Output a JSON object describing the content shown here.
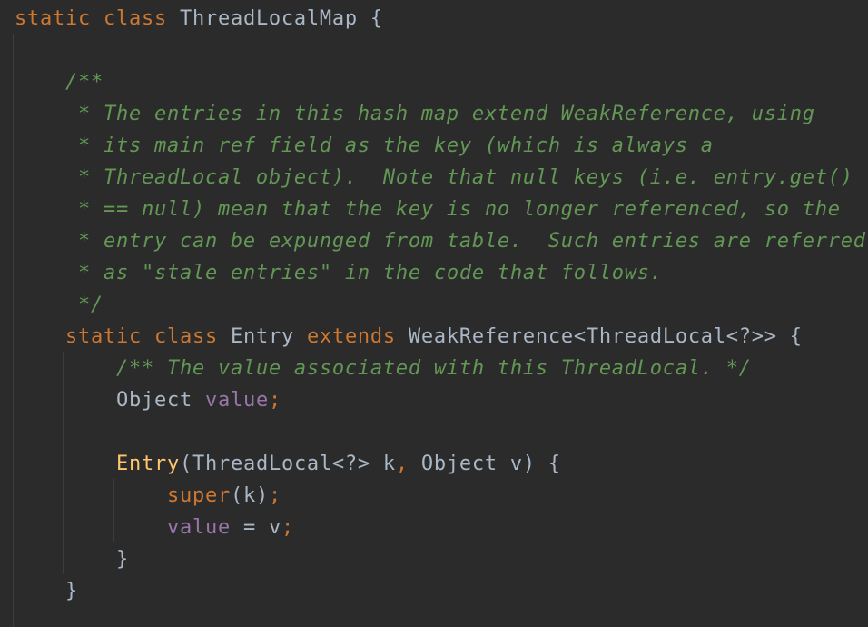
{
  "code": {
    "l1": {
      "kw1": "static",
      "kw2": "class",
      "name": "ThreadLocalMap",
      "brace": "{"
    },
    "l3": {
      "comment": "/**"
    },
    "l4": {
      "comment": " * The entries in this hash map extend WeakReference, using"
    },
    "l5": {
      "comment": " * its main ref field as the key (which is always a"
    },
    "l6": {
      "comment": " * ThreadLocal object).  Note that null keys (i.e. entry.get()"
    },
    "l7": {
      "comment": " * == null) mean that the key is no longer referenced, so the"
    },
    "l8": {
      "comment": " * entry can be expunged from table.  Such entries are referred"
    },
    "l9": {
      "comment": " * as \"stale entries\" in the code that follows."
    },
    "l10": {
      "comment": " */"
    },
    "l11": {
      "kw1": "static",
      "kw2": "class",
      "name": "Entry",
      "kw3": "extends",
      "type": "WeakReference<ThreadLocal<?>>",
      "brace": "{"
    },
    "l12": {
      "comment": "/** The value associated with this ThreadLocal. */"
    },
    "l13": {
      "type": "Object",
      "field": "value",
      "semi": ";"
    },
    "l15": {
      "ctor": "Entry",
      "params_a": "(ThreadLocal<?> k",
      "comma": ",",
      "params_b": " Object v) {"
    },
    "l16": {
      "kw": "super",
      "args": "(k)",
      "semi": ";"
    },
    "l17": {
      "field": "value",
      "assign": " = v",
      "semi": ";"
    },
    "l18": {
      "brace": "}"
    },
    "l19": {
      "brace": "}"
    }
  },
  "theme": {
    "background": "#2b2b2b",
    "keyword": "#cc7832",
    "comment": "#629755",
    "field": "#9876aa",
    "method": "#ffc66d",
    "text": "#a9b7c6"
  }
}
